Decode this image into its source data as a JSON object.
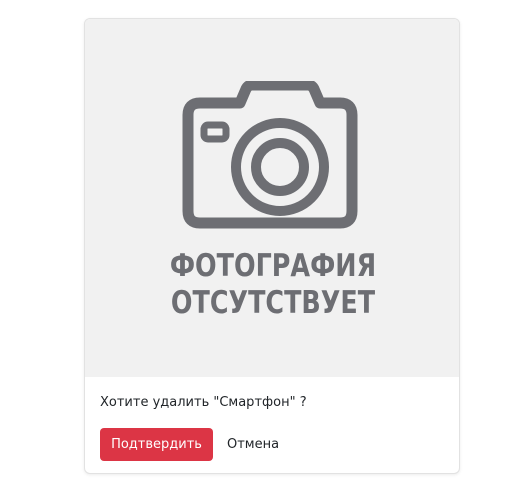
{
  "placeholder": {
    "icon": "camera-icon",
    "line1": "ФОТОГРАФИЯ",
    "line2": "ОТСУТСТВУЕТ"
  },
  "dialog": {
    "question": "Хотите удалить \"Смартфон\" ?",
    "confirm_label": "Подтвердить",
    "cancel_label": "Отмена"
  },
  "colors": {
    "confirm_bg": "#dc3545",
    "placeholder_bg": "#f1f1f1",
    "placeholder_fg": "#6d6e73"
  }
}
